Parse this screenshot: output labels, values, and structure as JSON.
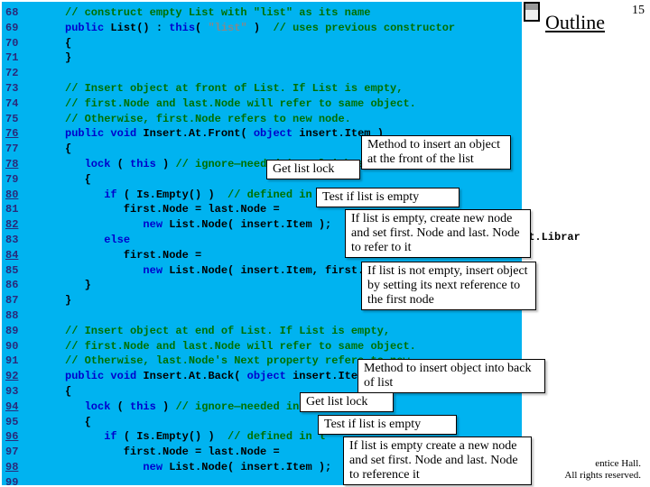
{
  "page_number": "15",
  "outline_label": "Outline",
  "gutter_lines": [
    "68",
    "69",
    "70",
    "71",
    "72",
    "73",
    "74",
    "75",
    "76",
    "77",
    "78",
    "79",
    "80",
    "81",
    "82",
    "83",
    "84",
    "85",
    "86",
    "87",
    "88",
    "89",
    "90",
    "91",
    "92",
    "93",
    "94",
    "95",
    "96",
    "97",
    "98",
    "99"
  ],
  "code_lines_html": [
    "<span class='cm'>// construct empty List with \"list\" as its name</span>",
    "<span class='kw'>public</span><span class='pln'> List() : </span><span class='kw'>this</span><span class='pln'>( </span><span class='str'>\"list\"</span><span class='pln'> )  </span><span class='cm'>// uses previous constructor</span>",
    "<span class='pln'>{</span>",
    "<span class='pln'>}</span>",
    "",
    "<span class='cm'>// Insert object at front of List. If List is empty,</span>",
    "<span class='cm'>// first.Node and last.Node will refer to same object.</span>",
    "<span class='cm'>// Otherwise, first.Node refers to new node.</span>",
    "<span class='kw'>public</span><span class='pln'> </span><span class='kw'>void</span><span class='pln'> Insert.At.Front( </span><span class='kw'>object</span><span class='pln'> insert.Item )</span>",
    "<span class='pln'>{</span>",
    "<span class='pln'>   </span><span class='kw'>lock</span><span class='pln'> ( </span><span class='kw'>this</span><span class='pln'> ) </span><span class='cm'>// ignore—needed in multithreaded s</span>",
    "<span class='pln'>   {</span>",
    "<span class='pln'>      </span><span class='kw'>if</span><span class='pln'> ( Is.Empty() )  </span><span class='cm'>// defined in line but ner</span>",
    "<span class='pln'>         first.Node = last.Node =</span>",
    "<span class='pln'>            </span><span class='kw'>new</span><span class='pln'> List.Node( insert.Item );</span>",
    "<span class='pln'>      </span><span class='kw'>else</span>",
    "<span class='pln'>         first.Node =</span>",
    "<span class='pln'>            </span><span class='kw'>new</span><span class='pln'> List.Node( insert.Item, first.Node</span>",
    "<span class='pln'>   }</span>",
    "<span class='pln'>}</span>",
    "",
    "<span class='cm'>// Insert object at end of List. If List is empty,</span>",
    "<span class='cm'>// first.Node and last.Node will refer to same object.</span>",
    "<span class='cm'>// Otherwise, last.Node's Next property refers to new</span>",
    "<span class='kw'>public</span><span class='pln'> </span><span class='kw'>void</span><span class='pln'> Insert.At.Back( </span><span class='kw'>object</span><span class='pln'> insert.Item )</span>",
    "<span class='pln'>{</span>",
    "<span class='pln'>   </span><span class='kw'>lock</span><span class='pln'> ( </span><span class='kw'>this</span><span class='pln'> ) </span><span class='cm'>// ignore—needed in multithreaded</span>",
    "<span class='pln'>   {</span>",
    "<span class='pln'>      </span><span class='kw'>if</span><span class='pln'> ( Is.Empty() )  </span><span class='cm'>// defined in l</span>",
    "<span class='pln'>         first.Node = last.Node =</span>",
    "<span class='pln'>            </span><span class='kw'>new</span><span class='pln'> List.Node( insert.Item );</span>",
    ""
  ],
  "annotations": {
    "a1": "Method to insert an\nobject at the front of\nthe list",
    "a2": "Get list lock",
    "a3": "Test if list is empty",
    "a4": "If list is empty, create new\nnode and set first. Node and\nlast. Node to refer to it",
    "a5": "If list is not empty, insert\nobject by setting its next\nreference to the first node",
    "a6": "Method to insert object into\nback of list",
    "a7": "Get list lock",
    "a8": "Test if list is empty",
    "a9": "If list is empty create a new\nnode and set first. Node and\nlast. Node to reference it"
  },
  "spillover": "st.Librar",
  "footer1": "entice Hall.",
  "footer2": "All rights reserved."
}
